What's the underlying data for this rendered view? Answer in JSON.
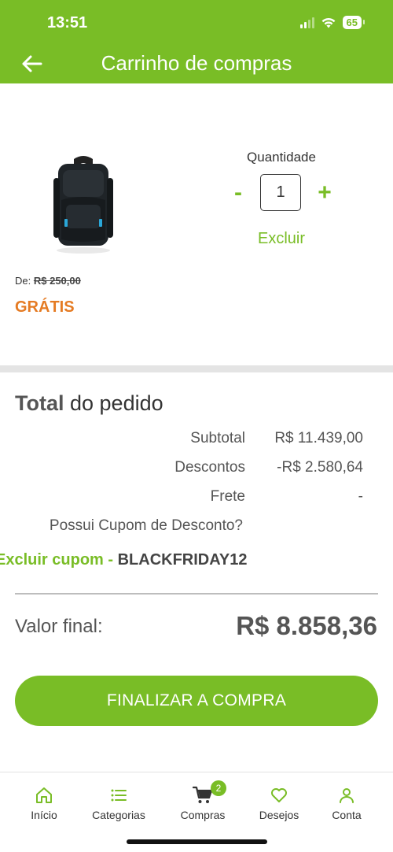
{
  "status_bar": {
    "time": "13:51",
    "battery": "65"
  },
  "header": {
    "title": "Carrinho de compras"
  },
  "product": {
    "quantity_label": "Quantidade",
    "quantity": "1",
    "minus": "-",
    "plus": "+",
    "remove_label": "Excluir",
    "old_price_prefix": "De:",
    "old_price": "R$ 250,00",
    "price": "GRÁTIS"
  },
  "summary": {
    "title_bold": "Total",
    "title_rest": " do pedido",
    "rows": [
      {
        "label": "Subtotal",
        "value": "R$ 11.439,00"
      },
      {
        "label": "Descontos",
        "value": "-R$ 2.580,64"
      },
      {
        "label": "Frete",
        "value": "-"
      }
    ],
    "coupon_question": "Possui Cupom de Desconto?",
    "coupon_remove": "Excluir cupom",
    "coupon_sep": " - ",
    "coupon_code": "BLACKFRIDAY12",
    "final_label": "Valor final:",
    "final_value": "R$ 8.858,36"
  },
  "checkout_button": "FINALIZAR A COMPRA",
  "bottom_nav": {
    "items": [
      {
        "label": "Início",
        "icon": "home-icon"
      },
      {
        "label": "Categorias",
        "icon": "list-icon"
      },
      {
        "label": "Compras",
        "icon": "cart-icon",
        "badge": "2"
      },
      {
        "label": "Desejos",
        "icon": "heart-icon"
      },
      {
        "label": "Conta",
        "icon": "user-icon"
      }
    ]
  },
  "colors": {
    "brand": "#79bd26",
    "accent_orange": "#e57b23"
  }
}
